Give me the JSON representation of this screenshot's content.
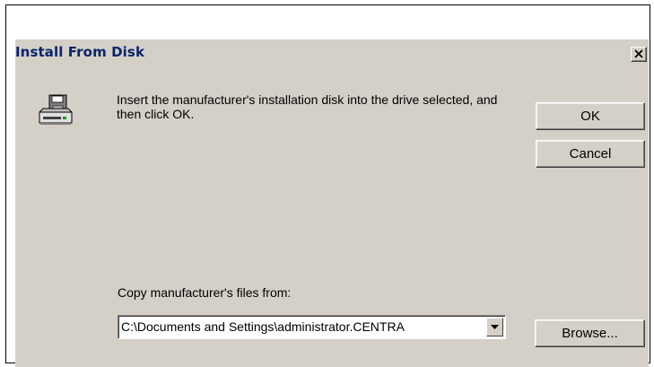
{
  "dialog": {
    "title": "Install From Disk",
    "message": "Insert the manufacturer's installation disk into the drive selected, and then click OK.",
    "ok_label": "OK",
    "cancel_label": "Cancel",
    "copy_label": "Copy manufacturer's files from:",
    "path_value": "C:\\Documents and Settings\\administrator.CENTRA",
    "browse_label": "Browse..."
  },
  "icons": {
    "disk": "floppy-disk-drive-icon",
    "close": "close-icon",
    "dropdown": "chevron-down-icon"
  },
  "colors": {
    "dialog_bg": "#d4d0c8",
    "title_text": "#0a246a"
  }
}
